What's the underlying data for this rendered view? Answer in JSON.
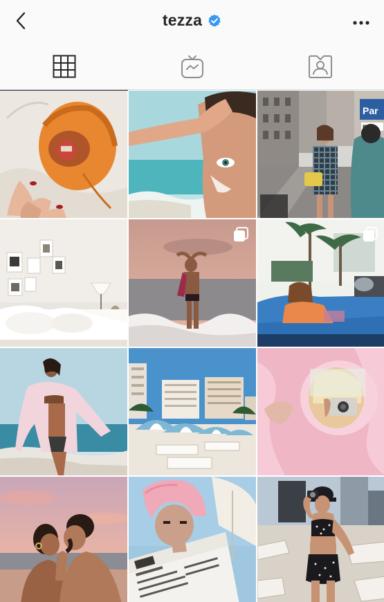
{
  "header": {
    "username": "tezza",
    "verified": true,
    "icons": {
      "back": "chevron-left-icon",
      "verified": "verified-badge-icon",
      "more": "more-dots-icon"
    },
    "accent_color": "#3897f0"
  },
  "tabs": [
    {
      "name": "posts-grid",
      "icon": "grid-icon",
      "active": true
    },
    {
      "name": "igtv",
      "icon": "igtv-icon",
      "active": false
    },
    {
      "name": "tagged",
      "icon": "tagged-person-icon",
      "active": false
    }
  ],
  "posts": [
    {
      "subject": "orange-pouch-bag",
      "multiple": false
    },
    {
      "subject": "beach-face-sunscreen",
      "multiple": false
    },
    {
      "subject": "city-street-plaid-outfit",
      "multiple": false,
      "sign_text": "Park"
    },
    {
      "subject": "bedroom-photo-wall",
      "multiple": false
    },
    {
      "subject": "sunset-ocean-waves",
      "multiple": true
    },
    {
      "subject": "palm-trees-convertible",
      "multiple": true
    },
    {
      "subject": "beach-pink-shirt",
      "multiple": false
    },
    {
      "subject": "beach-umbrellas-hotels",
      "multiple": false
    },
    {
      "subject": "camera-mirror-pink",
      "multiple": false
    },
    {
      "subject": "couple-sunset-kiss",
      "multiple": false
    },
    {
      "subject": "towel-newspaper",
      "multiple": false
    },
    {
      "subject": "beach-camera-bikini",
      "multiple": false
    }
  ]
}
